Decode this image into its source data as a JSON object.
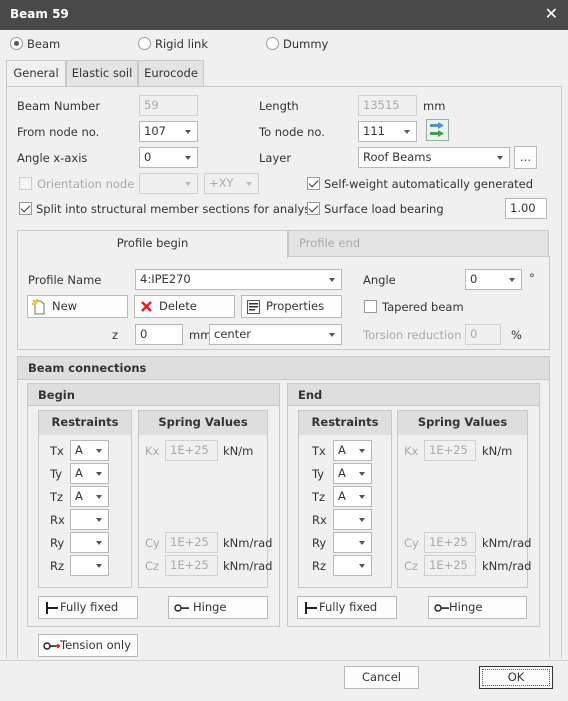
{
  "title": "Beam 59",
  "beam_types": [
    {
      "label": "Beam",
      "selected": true
    },
    {
      "label": "Rigid link",
      "selected": false
    },
    {
      "label": "Dummy",
      "selected": false
    }
  ],
  "tabs": [
    "General",
    "Elastic soil",
    "Eurocode"
  ],
  "general": {
    "beam_number_label": "Beam Number",
    "beam_number": "59",
    "length_label": "Length",
    "length": "13515",
    "length_unit": "mm",
    "from_node_label": "From node no.",
    "from_node": "107",
    "to_node_label": "To node no.",
    "to_node": "111",
    "angle_x_label": "Angle x-axis",
    "angle_x": "0",
    "layer_label": "Layer",
    "layer": "Roof Beams",
    "layer_more": "...",
    "orientation_node_label": "Orientation node",
    "orientation_axis": "+XY",
    "self_weight_label": "Self-weight automatically generated",
    "split_label": "Split into structural member sections for analysis",
    "surface_load_label": "Surface load bearing",
    "surface_load_value": "1.00"
  },
  "profile": {
    "tabs": [
      "Profile begin",
      "Profile end"
    ],
    "name_label": "Profile Name",
    "name": "4:IPE270",
    "angle_label": "Angle",
    "angle": "0",
    "angle_unit": "°",
    "new_label": "New",
    "delete_label": "Delete",
    "properties_label": "Properties",
    "tapered_label": "Tapered beam",
    "z_label": "z",
    "z_value": "0",
    "z_unit": "mm",
    "z_align": "center",
    "torsion_label": "Torsion reduction",
    "torsion_value": "0",
    "torsion_unit": "%"
  },
  "connections": {
    "title": "Beam connections",
    "restraints_label": "Restraints",
    "spring_label": "Spring Values",
    "fully_fixed_label": "Fully fixed",
    "hinge_label": "Hinge",
    "tension_only_label": "Tension only",
    "begin": {
      "title": "Begin",
      "restraints": [
        {
          "dof": "Tx",
          "value": "A"
        },
        {
          "dof": "Ty",
          "value": "A"
        },
        {
          "dof": "Tz",
          "value": "A"
        },
        {
          "dof": "Rx",
          "value": ""
        },
        {
          "dof": "Ry",
          "value": ""
        },
        {
          "dof": "Rz",
          "value": ""
        }
      ],
      "springs": [
        {
          "name": "Kx",
          "value": "1E+25",
          "unit": "kN/m"
        },
        {
          "name": "Cy",
          "value": "1E+25",
          "unit": "kNm/rad"
        },
        {
          "name": "Cz",
          "value": "1E+25",
          "unit": "kNm/rad"
        }
      ]
    },
    "end": {
      "title": "End",
      "restraints": [
        {
          "dof": "Tx",
          "value": "A"
        },
        {
          "dof": "Ty",
          "value": "A"
        },
        {
          "dof": "Tz",
          "value": "A"
        },
        {
          "dof": "Rx",
          "value": ""
        },
        {
          "dof": "Ry",
          "value": ""
        },
        {
          "dof": "Rz",
          "value": ""
        }
      ],
      "springs": [
        {
          "name": "Kx",
          "value": "1E+25",
          "unit": "kN/m"
        },
        {
          "name": "Cy",
          "value": "1E+25",
          "unit": "kNm/rad"
        },
        {
          "name": "Cz",
          "value": "1E+25",
          "unit": "kNm/rad"
        }
      ]
    }
  },
  "footer": {
    "cancel_label": "Cancel",
    "ok_label": "OK"
  }
}
